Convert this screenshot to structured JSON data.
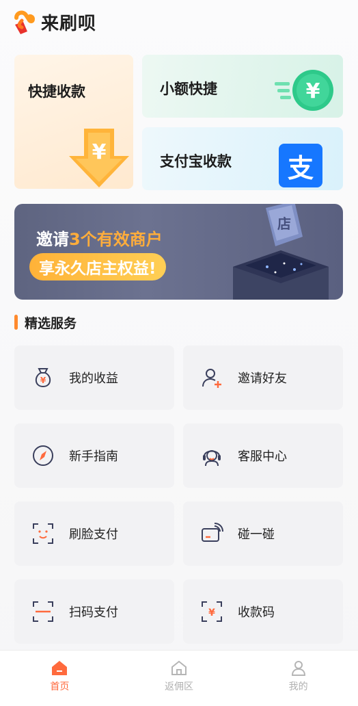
{
  "app": {
    "title": "来刷呗"
  },
  "cards": {
    "quick": {
      "label": "快捷收款"
    },
    "small": {
      "label": "小额快捷"
    },
    "alipay": {
      "label": "支付宝收款",
      "icon_char": "支"
    }
  },
  "banner": {
    "prefix": "邀请",
    "highlight": "3个有效商户",
    "line2": "享永久店主权益!",
    "store_char": "店"
  },
  "section": {
    "title": "精选服务"
  },
  "services": [
    {
      "label": "我的收益",
      "icon": "money-bag-icon"
    },
    {
      "label": "邀请好友",
      "icon": "add-user-icon"
    },
    {
      "label": "新手指南",
      "icon": "compass-icon"
    },
    {
      "label": "客服中心",
      "icon": "headset-icon"
    },
    {
      "label": "刷脸支付",
      "icon": "face-scan-icon"
    },
    {
      "label": "碰一碰",
      "icon": "nfc-card-icon"
    },
    {
      "label": "扫码支付",
      "icon": "scan-icon"
    },
    {
      "label": "收款码",
      "icon": "payment-code-icon"
    }
  ],
  "nav": {
    "home": "首页",
    "rebate": "返佣区",
    "mine": "我的"
  },
  "colors": {
    "accent": "#ff6a3d",
    "orange": "#ffad3b",
    "green": "#2ec98a",
    "alipay_blue": "#1677ff",
    "banner_bg": "#646a88"
  }
}
